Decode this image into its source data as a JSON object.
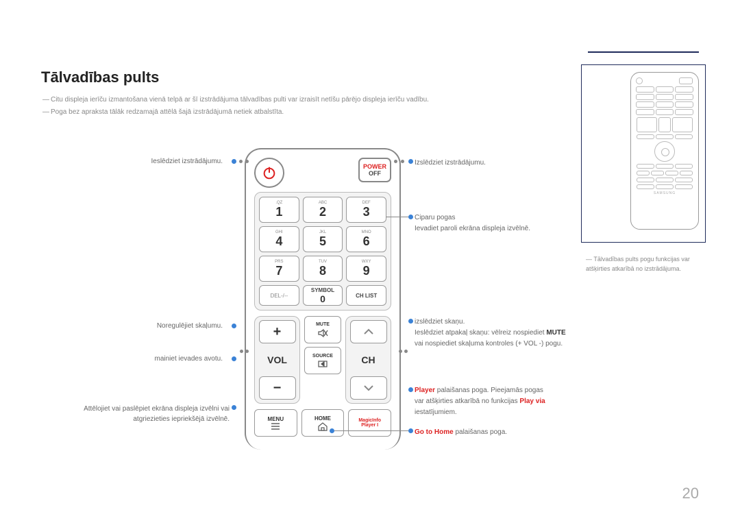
{
  "title": "Tālvadības pults",
  "note1": "Citu displeja ierīču izmantošana vienā telpā ar šī izstrādājuma tālvadības pulti var izraisīt netīšu pārējo displeja ierīču vadību.",
  "note2": "Poga bez apraksta tālāk redzamajā attēlā šajā izstrādājumā netiek atbalstīta.",
  "dash": "―",
  "power": {
    "top": "POWER",
    "bot": "OFF"
  },
  "keys": {
    "r1": [
      {
        "s": ".QZ",
        "n": "1"
      },
      {
        "s": "ABC",
        "n": "2"
      },
      {
        "s": "DEF",
        "n": "3"
      }
    ],
    "r2": [
      {
        "s": "GHI",
        "n": "4"
      },
      {
        "s": "JKL",
        "n": "5"
      },
      {
        "s": "MNO",
        "n": "6"
      }
    ],
    "r3": [
      {
        "s": "PRS",
        "n": "7"
      },
      {
        "s": "TUV",
        "n": "8"
      },
      {
        "s": "WXY",
        "n": "9"
      }
    ],
    "r4": [
      {
        "l": "DEL-/--"
      },
      {
        "l": "SYMBOL",
        "n": "0"
      },
      {
        "l": "CH LIST"
      }
    ]
  },
  "vol": "VOL",
  "ch": "CH",
  "mute": "MUTE",
  "source": "SOURCE",
  "menu": "MENU",
  "home": "HOME",
  "magic": {
    "l1": "MagicInfo",
    "l2": "Player I"
  },
  "labels": {
    "l1": "Ieslēdziet izstrādājumu.",
    "l2": "Noregulējiet skaļumu.",
    "l3": "mainiet ievades avotu.",
    "l4a": "Attēlojiet vai paslēpiet ekrāna displeja izvēlni vai",
    "l4b": "atgriezieties iepriekšējā izvēlnē.",
    "r1": "Izslēdziet izstrādājumu.",
    "r2a": "Ciparu pogas",
    "r2b": "Ievadiet paroli ekrāna displeja izvēlnē.",
    "r3a": "izslēdziet skaņu.",
    "r3b1": "Ieslēdziet atpakaļ skaņu: vēlreiz nospiediet ",
    "r3b2": "MUTE",
    "r3c": "vai nospiediet skaļuma kontroles (+ VOL -) pogu.",
    "r4a": "Player",
    "r4b": " palaišanas poga. Pieejamās pogas",
    "r4c": "var atšķirties atkarībā no funkcijas ",
    "r4d": "Play via",
    "r4e": "iestatījumiem.",
    "r5a": "Go to Home",
    "r5b": " palaišanas poga."
  },
  "sidenote": "Tālvadības pults pogu funkcijas var atšķirties atkarībā no izstrādājuma.",
  "brand": "SAMSUNG",
  "page": "20"
}
